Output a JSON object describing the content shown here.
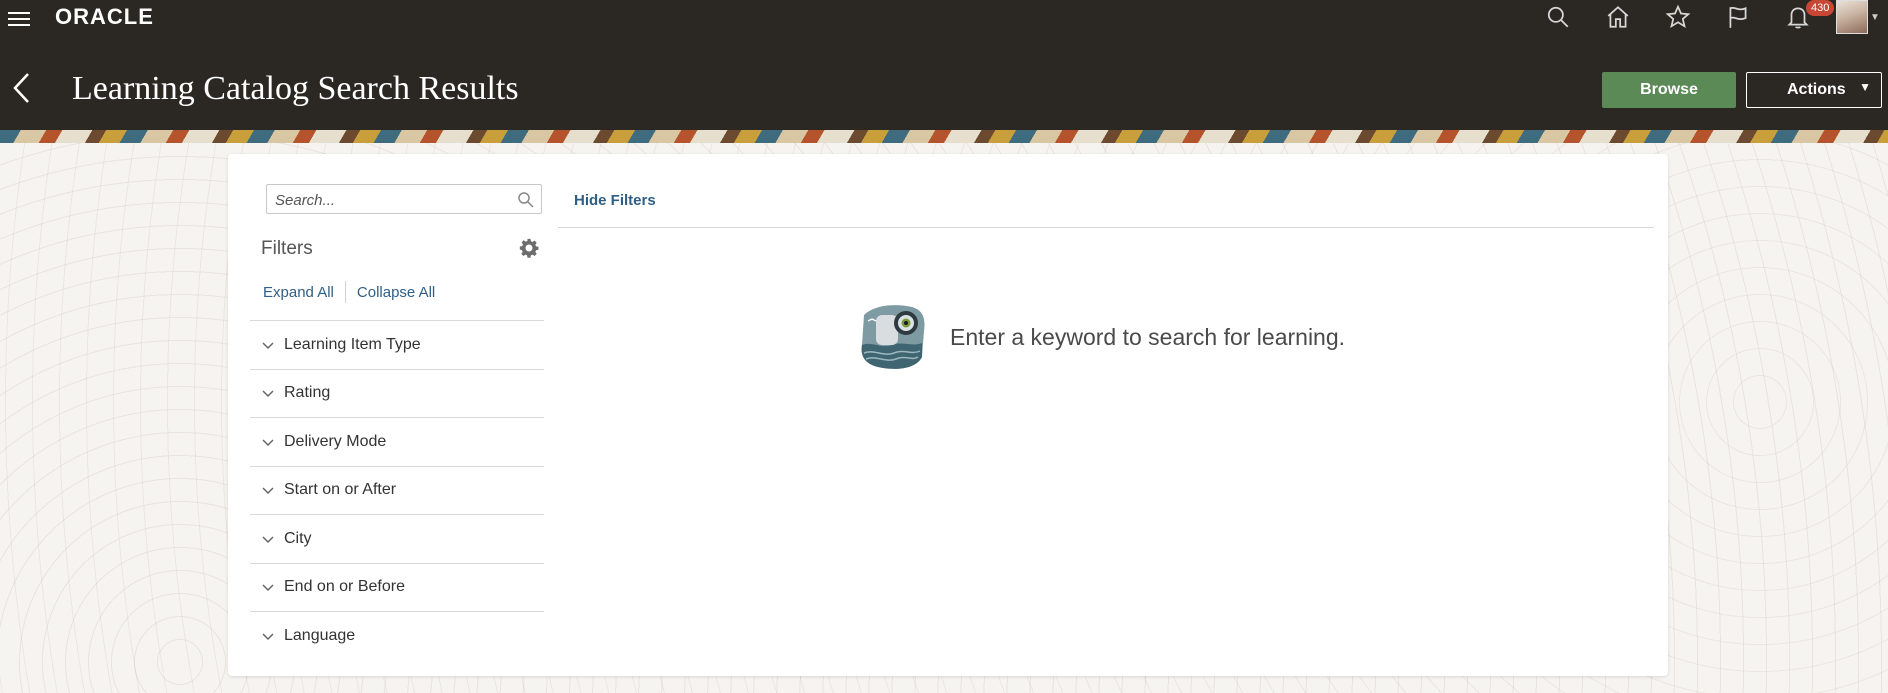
{
  "header": {
    "logo": "ORACLE",
    "title": "Learning Catalog Search Results",
    "notifications_count": "430",
    "browse_label": "Browse",
    "actions_label": "Actions"
  },
  "search": {
    "placeholder": "Search...",
    "value": ""
  },
  "filters": {
    "heading": "Filters",
    "expand_all": "Expand All",
    "collapse_all": "Collapse All",
    "hide_filters": "Hide Filters",
    "items": [
      {
        "label": "Learning Item Type"
      },
      {
        "label": "Rating"
      },
      {
        "label": "Delivery Mode"
      },
      {
        "label": "Start on or After"
      },
      {
        "label": "City"
      },
      {
        "label": "End on or Before"
      },
      {
        "label": "Language"
      }
    ]
  },
  "empty_state": {
    "message": "Enter a keyword to search for learning."
  },
  "colors": {
    "header_bg": "#2b2823",
    "browse_green": "#5b8a57",
    "link_blue": "#2f5f86",
    "badge_red": "#c74634"
  },
  "icons": {
    "menu": "hamburger-icon",
    "search": "search-icon",
    "home": "home-icon",
    "favorites": "star-icon",
    "watchlist": "flag-icon",
    "notifications": "bell-icon",
    "settings": "gear-icon",
    "back": "back-arrow-icon"
  }
}
